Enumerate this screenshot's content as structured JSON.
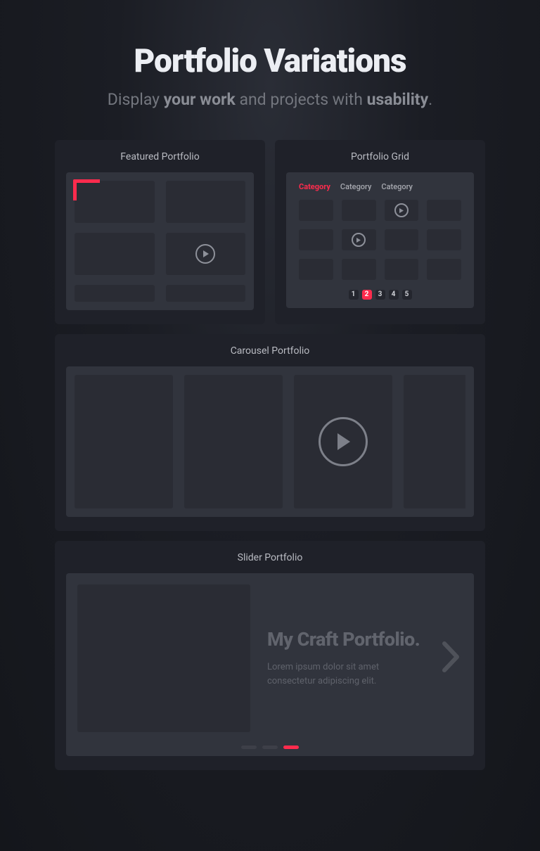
{
  "header": {
    "title": "Portfolio Variations",
    "subtitle_pre": "Display ",
    "subtitle_b1": "your work",
    "subtitle_mid": " and projects with ",
    "subtitle_b2": "usability",
    "subtitle_end": "."
  },
  "featured": {
    "title": "Featured Portfolio"
  },
  "grid": {
    "title": "Portfolio Grid",
    "tabs": [
      "Category",
      "Category",
      "Category"
    ],
    "active_tab": 0,
    "pages": [
      "1",
      "2",
      "3",
      "4",
      "5"
    ],
    "active_page": 1
  },
  "carousel": {
    "title": "Carousel Portfolio"
  },
  "slider": {
    "title": "Slider Portfolio",
    "heading": "My Craft Portfolio.",
    "body": "Lorem ipsum dolor sit amet consectetur adipiscing elit.",
    "active_dot": 2
  },
  "colors": {
    "accent": "#ff2b4d"
  }
}
